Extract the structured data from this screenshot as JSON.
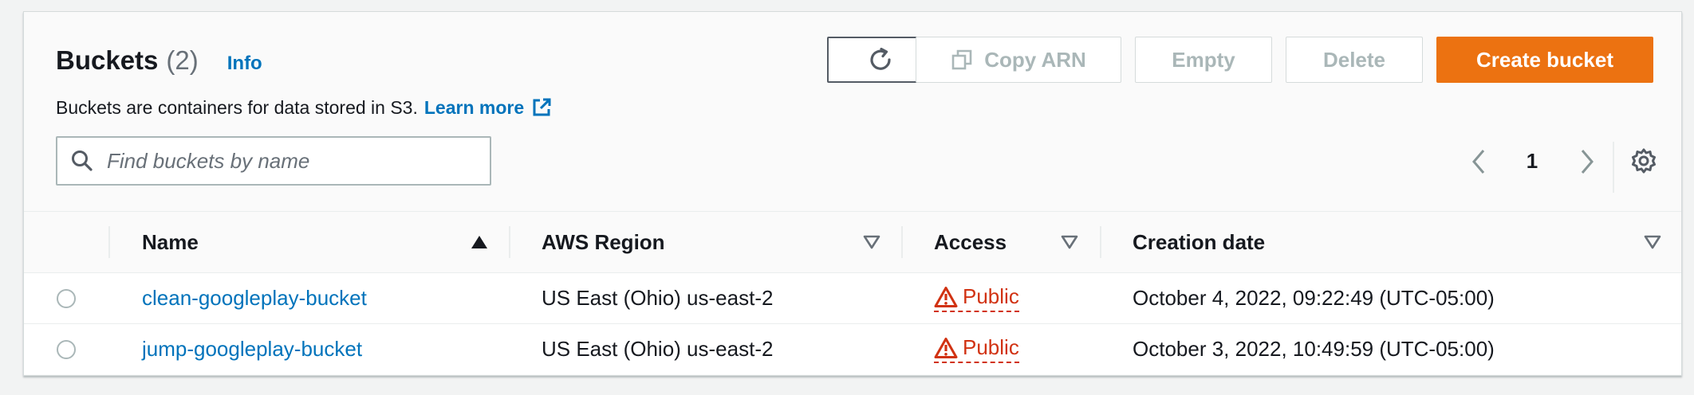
{
  "header": {
    "title": "Buckets",
    "count": "(2)",
    "info_link": "Info",
    "description": "Buckets are containers for data stored in S3.",
    "learn_more": "Learn more"
  },
  "toolbar": {
    "refresh_icon": "refresh-icon",
    "copy_arn_label": "Copy ARN",
    "empty_label": "Empty",
    "delete_label": "Delete",
    "create_label": "Create bucket"
  },
  "search": {
    "placeholder": "Find buckets by name",
    "value": ""
  },
  "pagination": {
    "current_page": "1"
  },
  "table": {
    "columns": [
      "Name",
      "AWS Region",
      "Access",
      "Creation date"
    ],
    "rows": [
      {
        "name": "clean-googleplay-bucket",
        "region": "US East (Ohio) us-east-2",
        "access": "Public",
        "created": "October 4, 2022, 09:22:49 (UTC-05:00)"
      },
      {
        "name": "jump-googleplay-bucket",
        "region": "US East (Ohio) us-east-2",
        "access": "Public",
        "created": "October 3, 2022, 10:49:59 (UTC-05:00)"
      }
    ]
  },
  "colors": {
    "link": "#0073bb",
    "primary_button": "#ec7211",
    "public_warning": "#d13212",
    "disabled_text": "#aab7b8"
  }
}
